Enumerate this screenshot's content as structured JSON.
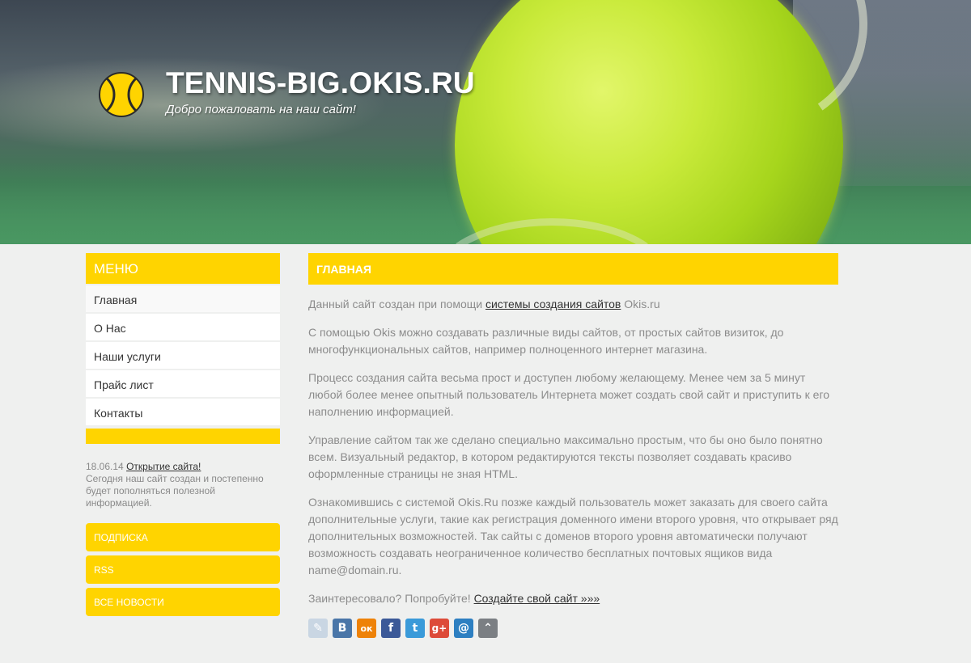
{
  "header": {
    "title": "TENNIS-BIG.OKIS.RU",
    "subtitle": "Добро пожаловать на наш сайт!"
  },
  "sidebar": {
    "menu_title": "МЕНЮ",
    "items": [
      {
        "label": "Главная"
      },
      {
        "label": "О Нас"
      },
      {
        "label": "Наши услуги"
      },
      {
        "label": "Прайс лист"
      },
      {
        "label": "Контакты"
      }
    ],
    "news": {
      "date": "18.06.14",
      "link": "Открытие сайта!",
      "text": "Сегодня наш сайт создан и постепенно будет пополняться полезной информацией."
    },
    "buttons": [
      {
        "label": "ПОДПИСКА"
      },
      {
        "label": "RSS"
      },
      {
        "label": "ВСЕ НОВОСТИ"
      }
    ]
  },
  "main": {
    "heading": "ГЛАВНАЯ",
    "p1_before": "Данный сайт создан при помощи ",
    "p1_link": "системы создания сайтов",
    "p1_after": " Okis.ru",
    "p2": "С помощью Okis можно создавать различные виды сайтов, от простых сайтов визиток, до многофункциональных сайтов, например полноценного интернет магазина.",
    "p3": "Процесс создания сайта весьма прост и доступен любому желающему. Менее чем за 5 минут любой более менее опытный пользователь Интернета может создать свой сайт и приступить к его наполнению информацией.",
    "p4": "Управление сайтом так же сделано специально максимально простым, что бы оно было понятно всем. Визуальный редактор, в котором редактируются тексты позволяет создавать красиво оформленные страницы не зная HTML.",
    "p5": "Ознакомившись с системой Okis.Ru позже каждый пользователь может заказать для своего сайта дополнительные услуги, такие как регистрация доменного имени второго уровня, что открывает ряд дополнительных возможностей. Так сайты с доменов второго уровня автоматически получают возможность создавать неограниченное количество бесплатных почтовых ящиков вида name@domain.ru.",
    "p6_before": "Заинтересовало? Попробуйте! ",
    "p6_link": "Создайте свой сайт »»»"
  },
  "social": [
    {
      "icon": "livejournal-icon",
      "glyph": "✎",
      "color": "#c9d6e3"
    },
    {
      "icon": "vkontakte-icon",
      "glyph": "В",
      "color": "#4a76a8"
    },
    {
      "icon": "odnoklassniki-icon",
      "glyph": "ок",
      "color": "#ee8208"
    },
    {
      "icon": "facebook-icon",
      "glyph": "f",
      "color": "#3b5998"
    },
    {
      "icon": "twitter-icon",
      "glyph": "t",
      "color": "#3a9ad9"
    },
    {
      "icon": "google-plus-icon",
      "glyph": "g+",
      "color": "#dd4b39"
    },
    {
      "icon": "mail-ru-icon",
      "glyph": "@",
      "color": "#2d7fc1"
    },
    {
      "icon": "more-icon",
      "glyph": "⌃",
      "color": "#7b7f83"
    }
  ],
  "colors": {
    "accent": "#ffd400",
    "page_bg": "#eff0ef",
    "text_muted": "#8c8c8c"
  }
}
